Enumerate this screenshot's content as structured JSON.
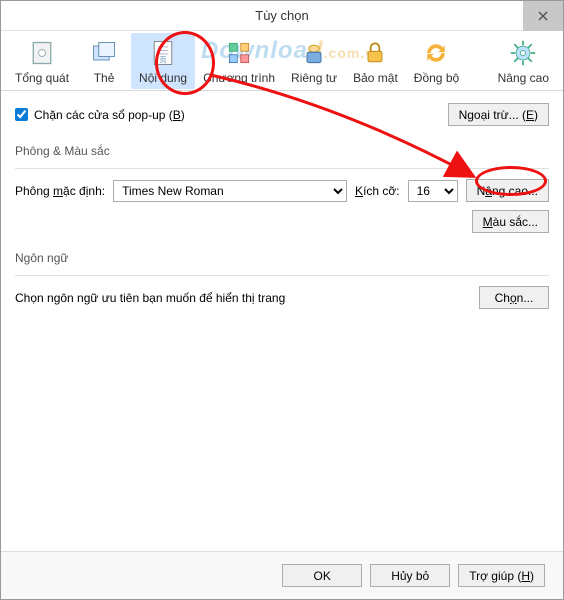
{
  "window": {
    "title": "Tùy chọn"
  },
  "watermark": {
    "brand1": "Downloa",
    "brand2": "d",
    "suffix": ".com.vn"
  },
  "tabs": [
    {
      "label": "Tổng quát",
      "icon": "general"
    },
    {
      "label": "Thẻ",
      "icon": "tabs"
    },
    {
      "label": "Nội dung",
      "icon": "content"
    },
    {
      "label": "Chương trình",
      "icon": "apps"
    },
    {
      "label": "Riêng tư",
      "icon": "privacy"
    },
    {
      "label": "Bảo mật",
      "icon": "security"
    },
    {
      "label": "Đồng bộ",
      "icon": "sync"
    },
    {
      "label": "Nâng cao",
      "icon": "advanced"
    }
  ],
  "popup": {
    "checkbox_label": "Chặn các cửa sổ pop-up (",
    "accel": "B",
    "checkbox_tail": ")",
    "exceptions_btn": "Ngoại trừ... (",
    "exceptions_accel": "E",
    "exceptions_tail": ")"
  },
  "fonts": {
    "section": "Phông & Màu sắc",
    "default_label_pre": "Phông ",
    "default_label_accel": "m",
    "default_label_post": "ặc định:",
    "font_value": "Times New Roman",
    "size_label_accel": "K",
    "size_label_post": "ích cỡ:",
    "size_value": "16",
    "advanced_btn_pre": "N",
    "advanced_btn_accel": "â",
    "advanced_btn_post": "ng cao...",
    "colors_btn_accel": "M",
    "colors_btn_post": "àu sắc..."
  },
  "lang": {
    "section": "Ngôn ngữ",
    "hint": "Chọn ngôn ngữ ưu tiên bạn muốn để hiển thị trang",
    "choose_btn": "Ch",
    "choose_accel": "ọ",
    "choose_post": "n..."
  },
  "buttons": {
    "ok": "OK",
    "cancel": "Hủy bỏ",
    "help_pre": "Trợ giúp (",
    "help_accel": "H",
    "help_post": ")"
  }
}
